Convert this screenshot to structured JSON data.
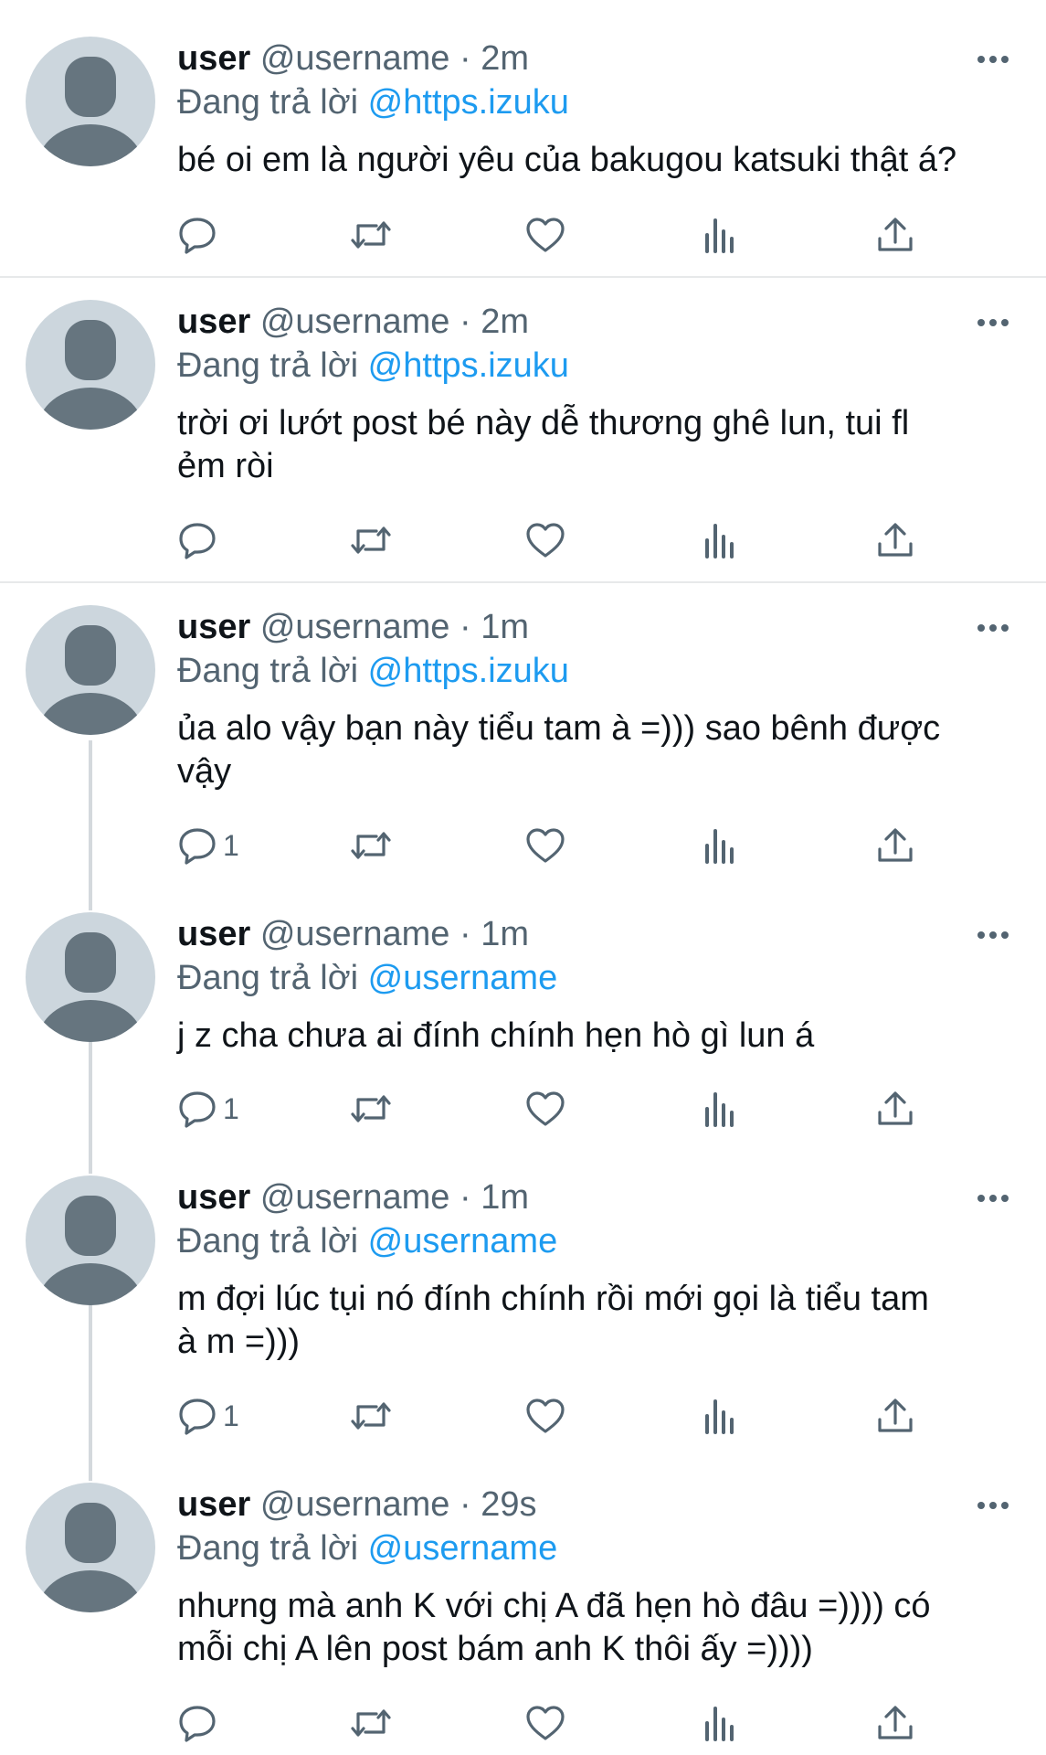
{
  "feed": {
    "tweets": [
      {
        "name": "user",
        "handle": "@username",
        "dot": "·",
        "time": "2m",
        "reply_prefix": "Đang trả lời",
        "reply_to": "@https.izuku",
        "text": "bé oi em là người yêu của bakugou katsuki thật á?",
        "reply_count": ""
      },
      {
        "name": "user",
        "handle": "@username",
        "dot": "·",
        "time": "2m",
        "reply_prefix": "Đang trả lời",
        "reply_to": "@https.izuku",
        "text": "trời ơi lướt post bé này dễ thương ghê lun, tui fl\nẻm ròi",
        "reply_count": ""
      },
      {
        "name": "user",
        "handle": "@username",
        "dot": "·",
        "time": "1m",
        "reply_prefix": "Đang trả lời",
        "reply_to": "@https.izuku",
        "text": "ủa alo vậy bạn này tiểu tam à =))) sao bênh được\nvậy",
        "reply_count": "1"
      },
      {
        "name": "user",
        "handle": "@username",
        "dot": "·",
        "time": "1m",
        "reply_prefix": "Đang trả lời",
        "reply_to": "@username",
        "text": "j z cha chưa ai đính chính hẹn hò gì lun á",
        "reply_count": "1"
      },
      {
        "name": "user",
        "handle": "@username",
        "dot": "·",
        "time": "1m",
        "reply_prefix": "Đang trả lời",
        "reply_to": "@username",
        "text": "m đợi lúc tụi nó đính chính rồi mới gọi là tiểu tam\nà m =)))",
        "reply_count": "1"
      },
      {
        "name": "user",
        "handle": "@username",
        "dot": "·",
        "time": "29s",
        "reply_prefix": "Đang trả lời",
        "reply_to": "@username",
        "text": "nhưng mà anh K với chị A đã hẹn hò đâu =)))) có\nmỗi chị A lên post bám anh K thôi ấy =))))",
        "reply_count": ""
      }
    ]
  },
  "colors": {
    "text": "#0f1419",
    "secondary": "#536471",
    "accent": "#1d9bf0",
    "avatar_bg": "#ccd6dd",
    "avatar_fg": "#66757f",
    "divider": "#e7e9ea",
    "thread_line": "#d4d9dd"
  },
  "icons": {
    "more": "more-dots-icon",
    "reply": "reply-bubble-icon",
    "retweet": "retweet-icon",
    "like": "heart-icon",
    "views": "views-chart-icon",
    "share": "share-upload-icon"
  }
}
